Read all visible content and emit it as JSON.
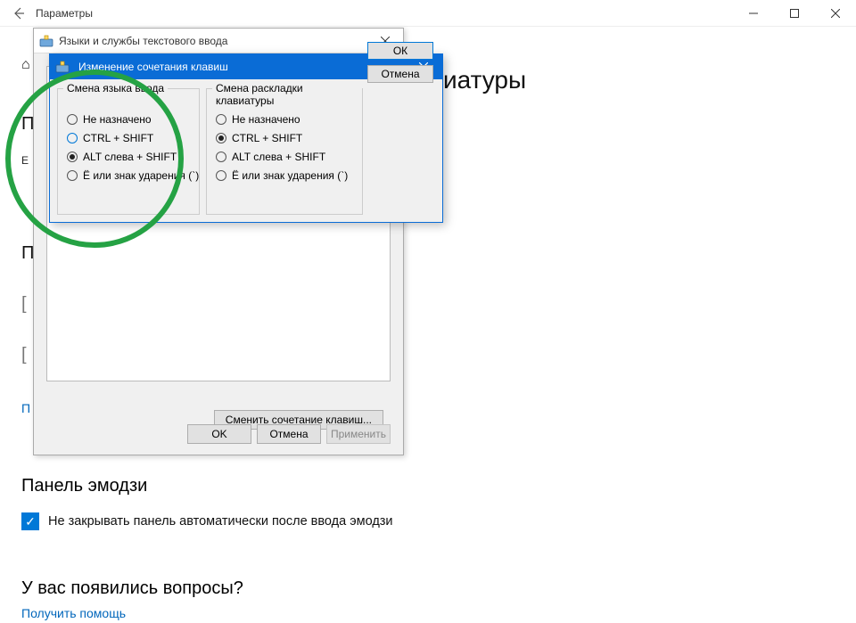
{
  "settings": {
    "title": "Параметры",
    "heading_visible_part": "иатуры"
  },
  "left_stubs": {
    "icon_peek": "⌂",
    "letter1": "П",
    "small1": "Е",
    "letter2": "П",
    "letter3": "[",
    "letter4": "[",
    "link_peek": "П"
  },
  "lang_dialog": {
    "title": "Языки и службы текстового ввода",
    "change_button": "Сменить сочетание клавиш...",
    "ok": "OK",
    "cancel": "Отмена",
    "apply": "Применить"
  },
  "hotkey_dialog": {
    "title": "Изменение сочетания клавиш",
    "group1_title": "Смена языка ввода",
    "group2_title": "Смена раскладки клавиатуры",
    "options": {
      "none": "Не назначено",
      "ctrl_shift": "CTRL + SHIFT",
      "alt_left_shift": "ALT слева + SHIFT",
      "yo_grave": "Ё или знак ударения (`)"
    },
    "group1_selected": "alt_left_shift",
    "group1_highlight": "ctrl_shift",
    "group2_selected": "ctrl_shift",
    "ok": "ОК",
    "cancel": "Отмена"
  },
  "emoji": {
    "heading": "Панель эмодзи",
    "checkbox_label": "Не закрывать панель автоматически после ввода эмодзи",
    "checked": true
  },
  "questions": {
    "heading": "У вас появились вопросы?",
    "help_link": "Получить помощь"
  }
}
